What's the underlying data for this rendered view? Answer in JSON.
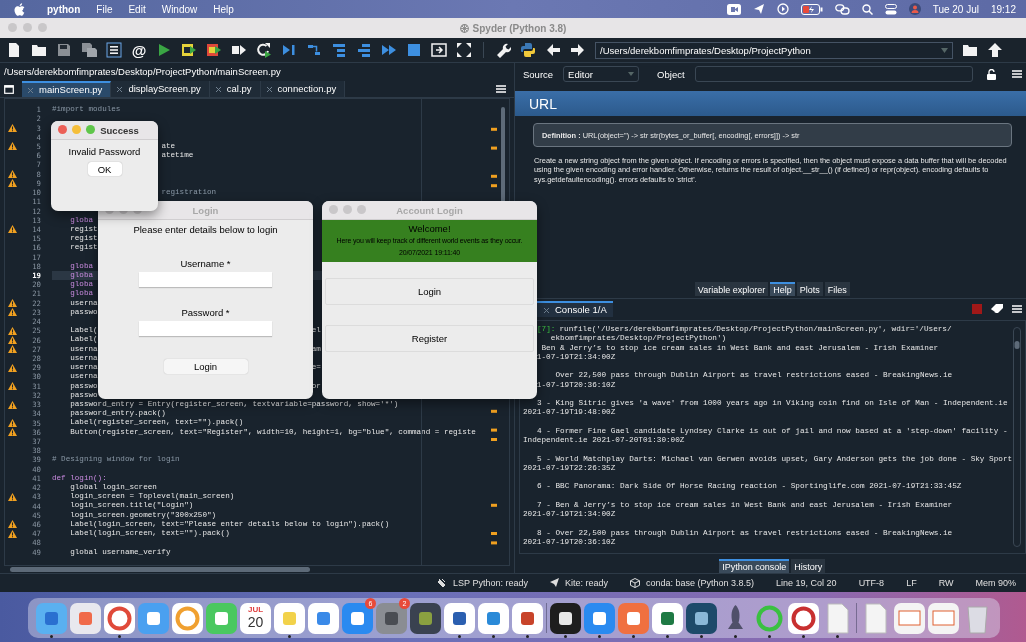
{
  "menubar": {
    "app": "python",
    "items": [
      "File",
      "Edit",
      "Window",
      "Help"
    ],
    "date": "Tue 20 Jul",
    "time": "19:12"
  },
  "window": {
    "title": "Spyder (Python 3.8)"
  },
  "toolbar": {
    "at_label": "@",
    "path": "/Users/derekbomfimprates/Desktop/ProjectPython"
  },
  "editor": {
    "path": "/Users/derekbomfimprates/Desktop/ProjectPython/mainScreen.py",
    "tabs": [
      {
        "label": "mainScreen.py",
        "selected": true
      },
      {
        "label": "displayScreen.py",
        "selected": false
      },
      {
        "label": "cal.py",
        "selected": false
      },
      {
        "label": "connection.py",
        "selected": false
      }
    ],
    "lines": [
      {
        "n": "1",
        "kind": "comment",
        "text": "#import modules",
        "warning": false,
        "current": false
      },
      {
        "n": "2",
        "kind": "code",
        "warning": false,
        "current": false
      },
      {
        "n": "3",
        "kind": "code",
        "warning": true,
        "current": false
      },
      {
        "n": "4",
        "kind": "code",
        "warning": false,
        "current": false
      },
      {
        "n": "5",
        "kind": "code",
        "text": "                        ate",
        "warning": true,
        "current": false
      },
      {
        "n": "6",
        "kind": "code",
        "text": "                        atetime",
        "warning": false,
        "current": false
      },
      {
        "n": "7",
        "kind": "code",
        "warning": false,
        "current": false
      },
      {
        "n": "8",
        "kind": "code",
        "warning": true,
        "current": false
      },
      {
        "n": "9",
        "kind": "code",
        "warning": true,
        "current": false
      },
      {
        "n": "10",
        "kind": "comment",
        "text": "                        registration",
        "warning": false,
        "current": false
      },
      {
        "n": "11",
        "kind": "code",
        "warning": false,
        "current": false
      },
      {
        "n": "12",
        "kind": "code",
        "warning": false,
        "current": false
      },
      {
        "n": "13",
        "kind": "keyword",
        "text": "    globa",
        "warning": false,
        "current": false
      },
      {
        "n": "14",
        "kind": "code",
        "text": "    regist",
        "warning": true,
        "current": false
      },
      {
        "n": "15",
        "kind": "code",
        "text": "    regist",
        "warning": false,
        "current": false
      },
      {
        "n": "16",
        "kind": "code",
        "text": "    regist",
        "warning": false,
        "current": false
      },
      {
        "n": "17",
        "kind": "code",
        "warning": false,
        "current": false
      },
      {
        "n": "18",
        "kind": "keyword",
        "text": "    globa",
        "warning": false,
        "current": false
      },
      {
        "n": "19",
        "kind": "keyword",
        "text": "    globa",
        "warning": false,
        "current": true
      },
      {
        "n": "20",
        "kind": "keyword",
        "text": "    globa",
        "warning": false,
        "current": false
      },
      {
        "n": "21",
        "kind": "keyword",
        "text": "    globa",
        "warning": false,
        "current": false
      },
      {
        "n": "22",
        "kind": "code",
        "text": "    userna",
        "warning": true,
        "current": false
      },
      {
        "n": "23",
        "kind": "code",
        "text": "    passwo",
        "warning": true,
        "current": false
      },
      {
        "n": "24",
        "kind": "code",
        "warning": false,
        "current": false
      },
      {
        "n": "25",
        "kind": "code",
        "text": "    Label(                                               el",
        "warning": true,
        "current": false
      },
      {
        "n": "26",
        "kind": "code",
        "text": "    Label(",
        "warning": true,
        "current": false
      },
      {
        "n": "27",
        "kind": "code",
        "text": "    userna                                               am",
        "warning": true,
        "current": false
      },
      {
        "n": "28",
        "kind": "code",
        "text": "    userna",
        "warning": false,
        "current": false
      },
      {
        "n": "29",
        "kind": "code",
        "text": "    userna                                               e=",
        "warning": true,
        "current": false
      },
      {
        "n": "30",
        "kind": "code",
        "text": "    userna",
        "warning": false,
        "current": false
      },
      {
        "n": "31",
        "kind": "code",
        "text": "    passwo                                               or",
        "warning": true,
        "current": false
      },
      {
        "n": "32",
        "kind": "code",
        "text": "    passwo",
        "warning": false,
        "current": false
      },
      {
        "n": "33",
        "kind": "code",
        "text": "    password_entry = Entry(register_screen, textvariable=password, show='*')",
        "warning": true,
        "current": false
      },
      {
        "n": "34",
        "kind": "code",
        "text": "    password_entry.pack()",
        "warning": false,
        "current": false
      },
      {
        "n": "35",
        "kind": "code",
        "text": "    Label(register_screen, text=\"\").pack()",
        "warning": true,
        "current": false
      },
      {
        "n": "36",
        "kind": "code",
        "text": "    Button(register_screen, text=\"Register\", width=10, height=1, bg=\"blue\", command = registe",
        "warning": true,
        "current": false
      },
      {
        "n": "37",
        "kind": "code",
        "warning": false,
        "current": false
      },
      {
        "n": "38",
        "kind": "code",
        "warning": false,
        "current": false
      },
      {
        "n": "39",
        "kind": "comment",
        "text": "# Designing window for login",
        "warning": false,
        "current": false
      },
      {
        "n": "40",
        "kind": "code",
        "warning": false,
        "current": false
      },
      {
        "n": "41",
        "kind": "keyword",
        "text": "def login():",
        "warning": false,
        "current": false
      },
      {
        "n": "42",
        "kind": "code",
        "text": "    global login_screen",
        "warning": false,
        "current": false
      },
      {
        "n": "43",
        "kind": "code",
        "text": "    login_screen = Toplevel(main_screen)",
        "warning": true,
        "current": false
      },
      {
        "n": "44",
        "kind": "code",
        "text": "    login_screen.title(\"Login\")",
        "warning": false,
        "current": false
      },
      {
        "n": "45",
        "kind": "code",
        "text": "    login_screen.geometry(\"300x250\")",
        "warning": false,
        "current": false
      },
      {
        "n": "46",
        "kind": "code",
        "text": "    Label(login_screen, text=\"Please enter details below to login\").pack()",
        "warning": true,
        "current": false
      },
      {
        "n": "47",
        "kind": "code",
        "text": "    Label(login_screen, text=\"\").pack()",
        "warning": true,
        "current": false
      },
      {
        "n": "48",
        "kind": "code",
        "warning": false,
        "current": false
      },
      {
        "n": "49",
        "kind": "code",
        "text": "    global username_verify",
        "warning": false,
        "current": false
      }
    ]
  },
  "help": {
    "source_label": "Source",
    "source_value": "Editor",
    "object_label": "Object",
    "heading": "URL",
    "definition": "**Definition :** URL(object='') -> str str(bytes_or_buffer[, encoding[, errors]]) -> str",
    "description": "Create a new string object from the given object. If encoding or errors is specified, then the object must expose a data buffer that will be decoded using the given encoding and error handler. Otherwise, returns the result of object.__str__() (if defined) or repr(object). encoding defaults to sys.getdefaultencoding(). errors defaults to 'strict'.",
    "tabs": [
      {
        "label": "Variable explorer",
        "selected": false
      },
      {
        "label": "Help",
        "selected": true
      },
      {
        "label": "Plots",
        "selected": false
      },
      {
        "label": "Files",
        "selected": false
      }
    ]
  },
  "console": {
    "tab": "Console 1/A",
    "prompt": "[7]:",
    "command": "runfile('/Users/derekbomfimprates/Desktop/ProjectPython/mainScreen.py', wdir='/Users/",
    "blocks": [
      [
        "   ekbomfimprates/Desktop/ProjectPython')",
        "    Ben & Jerry’s to stop ice cream sales in West Bank and east Jerusalem - Irish Examiner",
        "   1-07-19T21:34:00Z"
      ],
      [
        "    Over 22,500 pass through Dublin Airport as travel restrictions eased - BreakingNews.ie",
        "   1-07-19T20:36:10Z"
      ],
      [
        "3 - King Sitric gives 'a wave' from 1000 years ago in Viking coin find on Isle of Man - Independent.ie",
        "2021-07-19T19:48:00Z"
      ],
      [
        "4 - Former Fine Gael candidate Lyndsey Clarke is out of jail and now based at a 'step-down' facility -",
        "Independent.ie 2021-07-20T01:30:00Z"
      ],
      [
        "5 - World Matchplay Darts: Michael van Gerwen avoids upset, Gary Anderson gets the job done - Sky Sport",
        "2021-07-19T22:26:35Z"
      ],
      [
        "6 - BBC Panorama: Dark Side Of Horse Racing reaction - Sportinglife.com 2021-07-19T21:33:45Z"
      ],
      [
        "7 - Ben & Jerry’s to stop ice cream sales in West Bank and east Jerusalem - Irish Examiner",
        "2021-07-19T21:34:00Z"
      ],
      [
        "8 - Over 22,500 pass through Dublin Airport as travel restrictions eased - BreakingNews.ie",
        "2021-07-19T20:36:10Z"
      ]
    ],
    "tabs": [
      {
        "label": "IPython console",
        "selected": true
      },
      {
        "label": "History",
        "selected": false
      }
    ]
  },
  "status_bar": [
    {
      "kind": "lsp",
      "text": "LSP Python: ready"
    },
    {
      "kind": "kite",
      "text": "Kite: ready"
    },
    {
      "kind": "conda",
      "text": "conda: base (Python 3.8.5)"
    },
    {
      "kind": "plain",
      "text": "Line 19, Col 20"
    },
    {
      "kind": "plain",
      "text": "UTF-8"
    },
    {
      "kind": "plain",
      "text": "LF"
    },
    {
      "kind": "plain",
      "text": "RW"
    },
    {
      "kind": "plain",
      "text": "Mem 90%"
    }
  ],
  "dialogs": [
    {
      "kind": "message",
      "title": "Success",
      "active": true,
      "message": "Invalid Password",
      "button": "OK"
    },
    {
      "kind": "login",
      "title": "Login",
      "active": false,
      "prompt": "Please enter details below to login",
      "fields": [
        {
          "label": "Username *"
        },
        {
          "label": "Password *"
        }
      ],
      "button": "Login"
    },
    {
      "kind": "menu",
      "title": "Account Login",
      "active": false,
      "heading": "Welcome!",
      "text": "Here you will keep track of different world events as they occur.",
      "timestamp": "20/07/2021 19:11:40",
      "buttons": [
        "Login",
        "Register"
      ]
    }
  ],
  "dock": [
    {
      "kind": "finder",
      "running": true
    },
    {
      "kind": "launchpad",
      "running": false
    },
    {
      "kind": "chrome",
      "running": true
    },
    {
      "kind": "mail",
      "running": false
    },
    {
      "kind": "photos",
      "running": false
    },
    {
      "kind": "facetime",
      "running": false
    },
    {
      "kind": "calendar",
      "month": "JUL",
      "day": "20",
      "running": false
    },
    {
      "kind": "notes",
      "running": true
    },
    {
      "kind": "reminders",
      "running": false
    },
    {
      "kind": "appstore",
      "badge": "6",
      "running": false
    },
    {
      "kind": "settings",
      "badge": "2",
      "running": false
    },
    {
      "kind": "cube",
      "running": false
    },
    {
      "kind": "word",
      "running": true
    },
    {
      "kind": "vscode",
      "running": true
    },
    {
      "kind": "powerpoint",
      "running": true
    },
    {
      "kind": "divider"
    },
    {
      "kind": "terminal",
      "running": true
    },
    {
      "kind": "zoom",
      "running": true
    },
    {
      "kind": "postman",
      "running": true
    },
    {
      "kind": "excel",
      "running": true
    },
    {
      "kind": "mysql",
      "running": true
    },
    {
      "kind": "rocket",
      "running": true
    },
    {
      "kind": "ring",
      "running": true
    },
    {
      "kind": "spider",
      "running": true
    },
    {
      "kind": "document",
      "running": true
    },
    {
      "kind": "divider"
    },
    {
      "kind": "document",
      "running": false
    },
    {
      "kind": "screenshot",
      "running": false
    },
    {
      "kind": "screenshot",
      "running": false
    },
    {
      "kind": "trash",
      "running": false
    }
  ]
}
